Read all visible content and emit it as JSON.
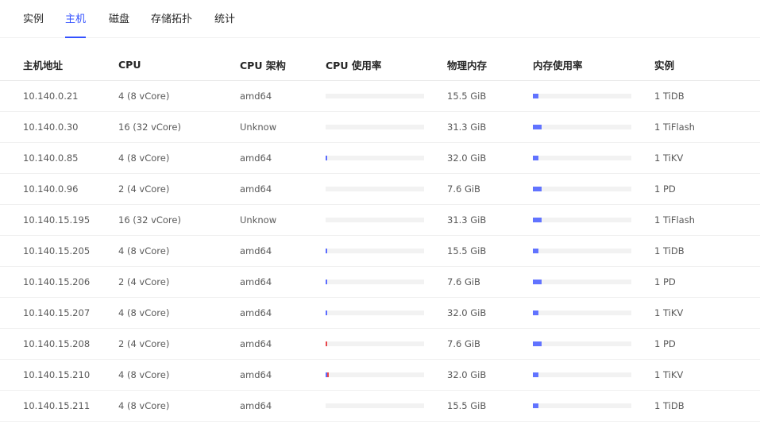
{
  "tabs": [
    {
      "label": "实例",
      "active": false
    },
    {
      "label": "主机",
      "active": true
    },
    {
      "label": "磁盘",
      "active": false
    },
    {
      "label": "存储拓扑",
      "active": false
    },
    {
      "label": "统计",
      "active": false
    }
  ],
  "colors": {
    "accent": "#3351ff",
    "bar_track": "#f2f2f2",
    "mem_fill": "#6173ff",
    "cpu_fill": "#5b6cff",
    "cpu_high": "#e8474c"
  },
  "table": {
    "columns": [
      "主机地址",
      "CPU",
      "CPU 架构",
      "CPU 使用率",
      "物理内存",
      "内存使用率",
      "实例"
    ],
    "rows": [
      {
        "host": "10.140.0.21",
        "cpu": "4 (8 vCore)",
        "arch": "amd64",
        "cpu_usage": 0,
        "memory": "15.5 GiB",
        "mem_usage": 0.05,
        "instance": "1 TiDB"
      },
      {
        "host": "10.140.0.30",
        "cpu": "16 (32 vCore)",
        "arch": "Unknow",
        "cpu_usage": 0,
        "memory": "31.3 GiB",
        "mem_usage": 0.08,
        "instance": "1 TiFlash"
      },
      {
        "host": "10.140.0.85",
        "cpu": "4 (8 vCore)",
        "arch": "amd64",
        "cpu_usage": 0.01,
        "memory": "32.0 GiB",
        "mem_usage": 0.05,
        "instance": "1 TiKV"
      },
      {
        "host": "10.140.0.96",
        "cpu": "2 (4 vCore)",
        "arch": "amd64",
        "cpu_usage": 0,
        "memory": "7.6 GiB",
        "mem_usage": 0.08,
        "instance": "1 PD"
      },
      {
        "host": "10.140.15.195",
        "cpu": "16 (32 vCore)",
        "arch": "Unknow",
        "cpu_usage": 0,
        "memory": "31.3 GiB",
        "mem_usage": 0.08,
        "instance": "1 TiFlash"
      },
      {
        "host": "10.140.15.205",
        "cpu": "4 (8 vCore)",
        "arch": "amd64",
        "cpu_usage": 0.01,
        "memory": "15.5 GiB",
        "mem_usage": 0.05,
        "instance": "1 TiDB"
      },
      {
        "host": "10.140.15.206",
        "cpu": "2 (4 vCore)",
        "arch": "amd64",
        "cpu_usage": 0.01,
        "memory": "7.6 GiB",
        "mem_usage": 0.08,
        "instance": "1 PD"
      },
      {
        "host": "10.140.15.207",
        "cpu": "4 (8 vCore)",
        "arch": "amd64",
        "cpu_usage": 0.01,
        "memory": "32.0 GiB",
        "mem_usage": 0.05,
        "instance": "1 TiKV"
      },
      {
        "host": "10.140.15.208",
        "cpu": "2 (4 vCore)",
        "arch": "amd64",
        "cpu_usage": 0.01,
        "cpu_high": true,
        "memory": "7.6 GiB",
        "mem_usage": 0.08,
        "instance": "1 PD"
      },
      {
        "host": "10.140.15.210",
        "cpu": "4 (8 vCore)",
        "arch": "amd64",
        "cpu_usage": 0.03,
        "cpu_high": true,
        "memory": "32.0 GiB",
        "mem_usage": 0.05,
        "instance": "1 TiKV"
      },
      {
        "host": "10.140.15.211",
        "cpu": "4 (8 vCore)",
        "arch": "amd64",
        "cpu_usage": 0,
        "memory": "15.5 GiB",
        "mem_usage": 0.05,
        "instance": "1 TiDB"
      }
    ]
  }
}
